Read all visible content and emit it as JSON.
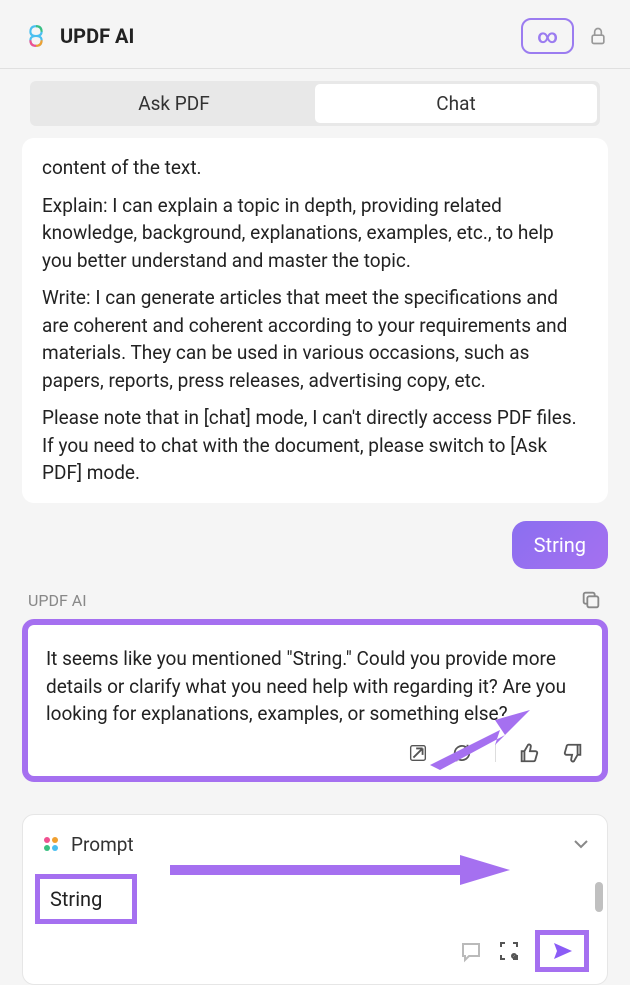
{
  "header": {
    "title": "UPDF AI"
  },
  "tabs": {
    "ask_pdf": "Ask PDF",
    "chat": "Chat"
  },
  "assistant_message": {
    "p1": "content of the text.",
    "p2": "Explain: I can explain a topic in depth, providing related knowledge, background, explanations, examples, etc., to help you better understand and master the topic.",
    "p3": "Write: I can generate articles that meet the specifications and are coherent and coherent according to your requirements and materials. They can be used in various occasions, such as papers, reports, press releases, advertising copy, etc.",
    "p4": "Please note that in [chat] mode, I can't directly access PDF files. If you need to chat with the document, please switch to [Ask PDF] mode."
  },
  "user_message": "String",
  "agent": {
    "label": "UPDF AI",
    "response": "It seems like you mentioned \"String.\" Could you provide more details or clarify what you need help with regarding it? Are you looking for explanations, examples, or something else?"
  },
  "prompt": {
    "label": "Prompt",
    "input_value": "String"
  }
}
